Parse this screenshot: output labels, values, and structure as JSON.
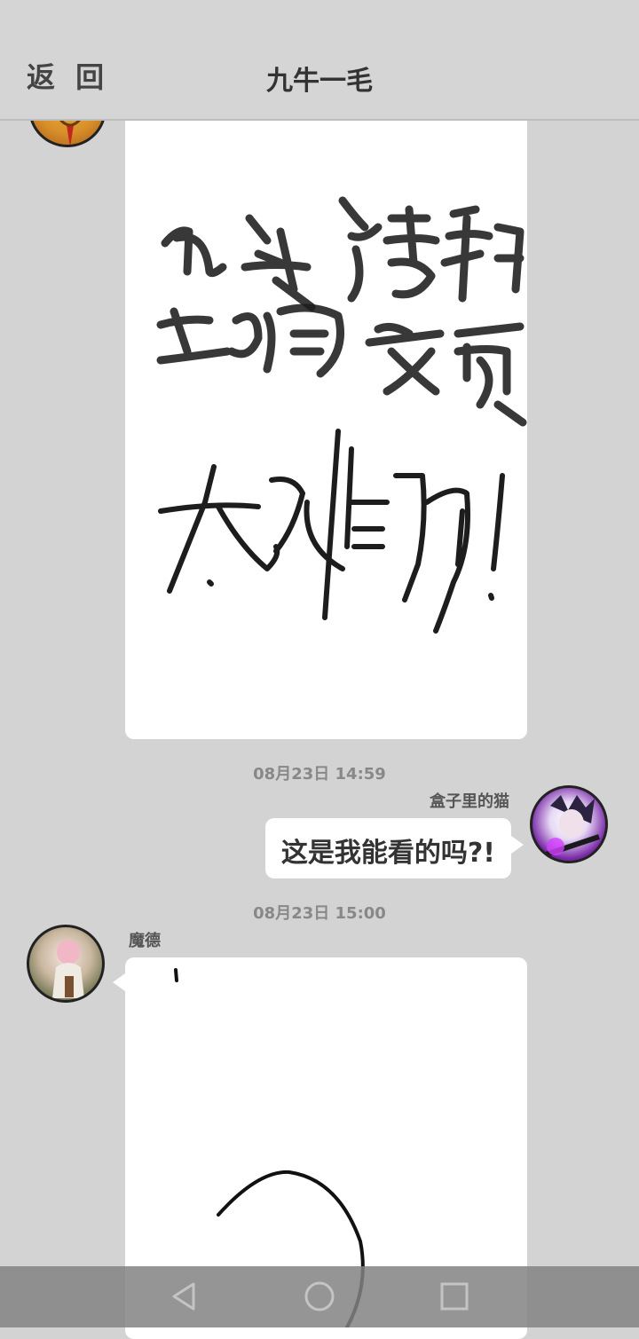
{
  "header": {
    "back_label": "返 回",
    "title": "九牛一毛"
  },
  "messages": [
    {
      "type": "drawing",
      "side": "left",
      "drawing_text": [
        "九头猪和",
        "土狗交配",
        "太难的!"
      ]
    },
    {
      "type": "timestamp",
      "text": "08月23日  14:59"
    },
    {
      "type": "text",
      "side": "right",
      "sender": "盒子里的猫",
      "text": "这是我能看的吗?!"
    },
    {
      "type": "timestamp",
      "text": "08月23日  15:00"
    },
    {
      "type": "drawing",
      "side": "left",
      "sender": "魔德"
    }
  ],
  "navbar": {
    "back_icon": "triangle-back-icon",
    "home_icon": "circle-home-icon",
    "recent_icon": "square-recents-icon"
  }
}
